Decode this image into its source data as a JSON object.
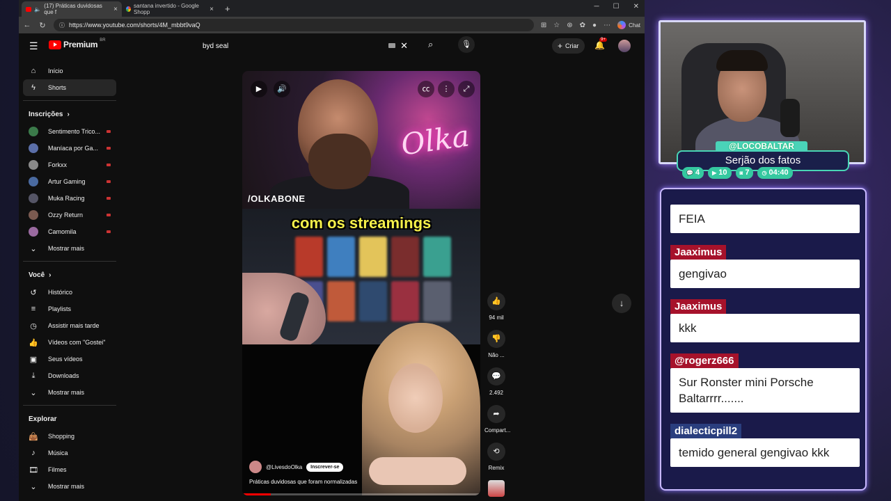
{
  "browser": {
    "tabs": [
      {
        "label": "(17) Práticas duvidosas que f",
        "active": true
      },
      {
        "label": "santana invertido - Google Shopp",
        "active": false
      }
    ],
    "url": "https://www.youtube.com/shorts/4M_mbbt9vaQ",
    "chat_label": "Chat"
  },
  "youtube": {
    "logo": "Premium",
    "logo_region": "BR",
    "search_value": "byd seal",
    "create_label": "Criar",
    "notif_count": "9+",
    "sidebar": {
      "main": [
        {
          "label": "Início",
          "icon": "home-icon"
        },
        {
          "label": "Shorts",
          "icon": "shorts-icon",
          "active": true
        }
      ],
      "subs_heading": "Inscrições",
      "subs": [
        {
          "label": "Sentimento Trico...",
          "color": "#3b7a4a"
        },
        {
          "label": "Maníaca por Ga...",
          "color": "#5b6fa8"
        },
        {
          "label": "Forkxx",
          "color": "#8a8a8a"
        },
        {
          "label": "Artur Gaming",
          "color": "#4a6aa0"
        },
        {
          "label": "Muka Racing",
          "color": "#556"
        },
        {
          "label": "Ozzy Return",
          "color": "#7a5a50"
        },
        {
          "label": "Camomila",
          "color": "#9a6aa0"
        }
      ],
      "subs_more": "Mostrar mais",
      "you_heading": "Você",
      "you": [
        {
          "label": "Histórico",
          "icon": "history-icon"
        },
        {
          "label": "Playlists",
          "icon": "playlist-icon"
        },
        {
          "label": "Assistir mais tarde",
          "icon": "clock-icon"
        },
        {
          "label": "Vídeos com \"Gostei\"",
          "icon": "thumbs-up-icon"
        },
        {
          "label": "Seus vídeos",
          "icon": "video-icon"
        },
        {
          "label": "Downloads",
          "icon": "download-icon"
        }
      ],
      "you_more": "Mostrar mais",
      "explore_heading": "Explorar",
      "explore": [
        {
          "label": "Shopping",
          "icon": "shopping-bag-icon"
        },
        {
          "label": "Música",
          "icon": "music-icon"
        },
        {
          "label": "Filmes",
          "icon": "film-icon"
        }
      ],
      "explore_more": "Mostrar mais"
    },
    "short": {
      "watermark": "/OLKABONE",
      "neon": "Olka",
      "caption": "com os streamings",
      "channel": "@LivesdoOlka",
      "subscribe": "Inscrever-se",
      "title": "Práticas duvidosas que foram normalizadas",
      "progress": 0.12
    },
    "actions": {
      "likes": "94 mil",
      "dislike": "Não ...",
      "comments": "2.492",
      "share": "Compart...",
      "remix": "Remix"
    }
  },
  "stream": {
    "handle": "@LOCOBALTAR",
    "title": "Serjão dos fatos",
    "stats": [
      {
        "icon": "chat-bubble-icon",
        "value": "4"
      },
      {
        "icon": "youtube-icon",
        "value": "10"
      },
      {
        "icon": "twitch-icon",
        "value": "7"
      },
      {
        "icon": "clock-icon",
        "value": "04:40"
      }
    ],
    "chat": [
      {
        "name": "",
        "text": "FEIA"
      },
      {
        "name": "Jaaximus",
        "text": "gengivao"
      },
      {
        "name": "Jaaximus",
        "text": "kkk"
      },
      {
        "name": "@rogerz666",
        "text": "Sur Ronster mini Porsche Baltarrrr......."
      },
      {
        "name": "dialecticpill2",
        "text": "temido general gengivao kkk"
      }
    ]
  }
}
